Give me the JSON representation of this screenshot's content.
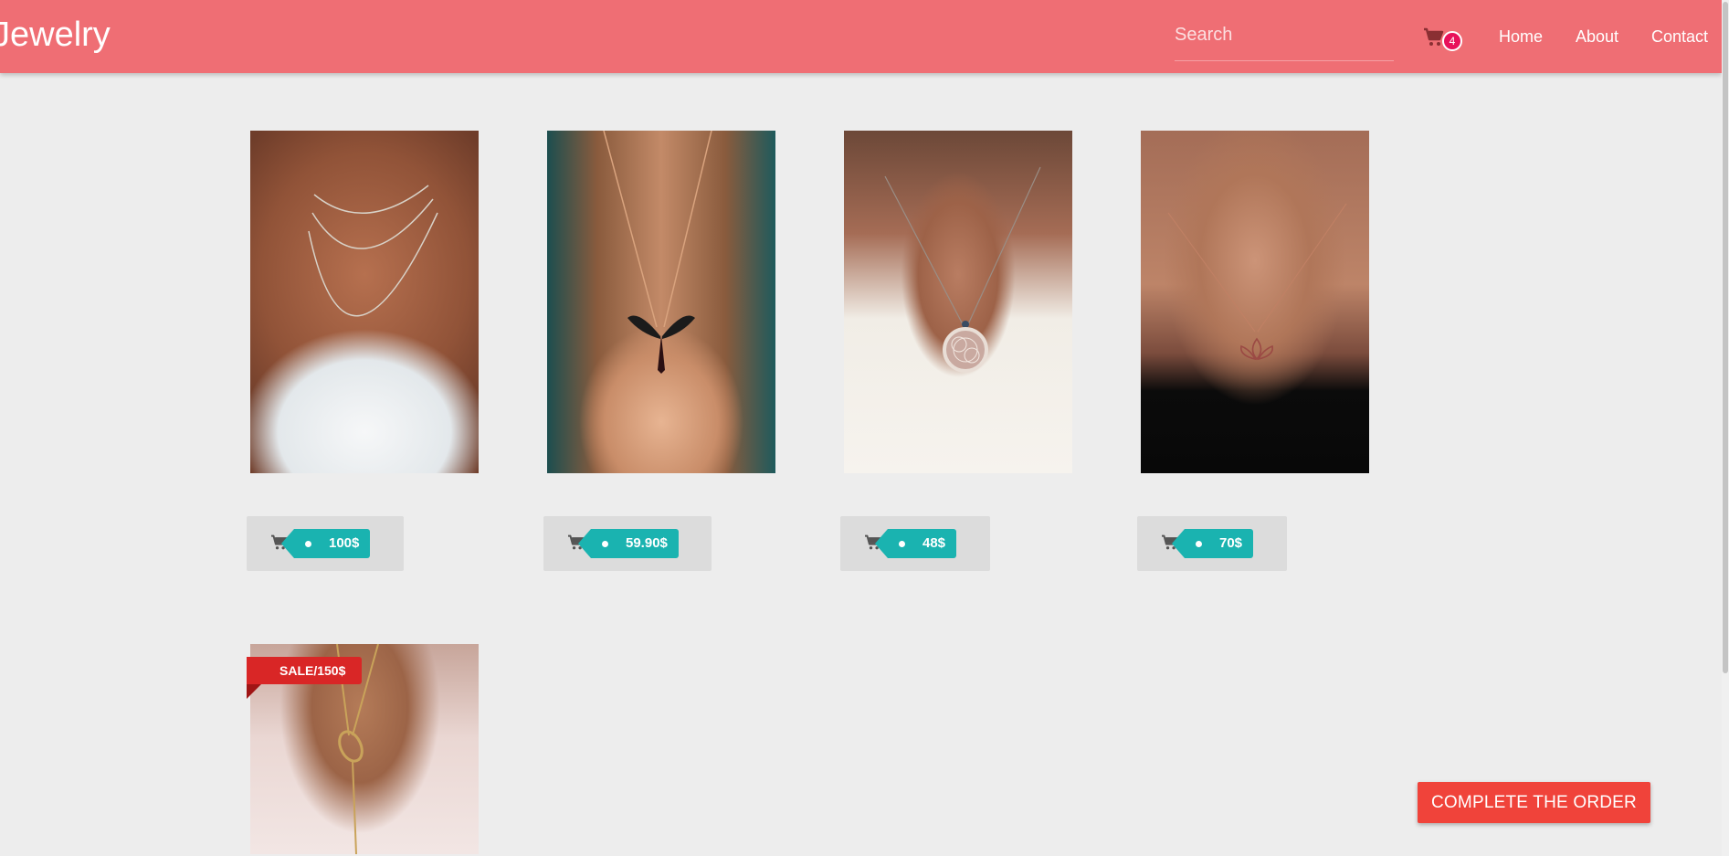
{
  "navbar": {
    "brand": "Jewelry",
    "search_placeholder": "Search",
    "cart_count": "4",
    "links": [
      "Home",
      "About",
      "Contact"
    ],
    "background_color": "#ef6e74"
  },
  "products": [
    {
      "price": "100$",
      "image": "layered-chain-necklaces-photo"
    },
    {
      "price": "59.90$",
      "image": "winged-pendant-necklace-photo"
    },
    {
      "price": "48$",
      "image": "flower-of-life-pendant-photo"
    },
    {
      "price": "70$",
      "image": "lotus-pendant-necklace-photo"
    },
    {
      "sale_label": "SALE/150$",
      "image": "lariat-ring-necklace-photo"
    }
  ],
  "actions": {
    "complete_order": "COMPLETE THE ORDER"
  },
  "colors": {
    "price_tag": "#1ab3b0",
    "sale_ribbon": "#d92626",
    "complete_button": "#f0433a",
    "cart_badge": "#e8115b"
  }
}
